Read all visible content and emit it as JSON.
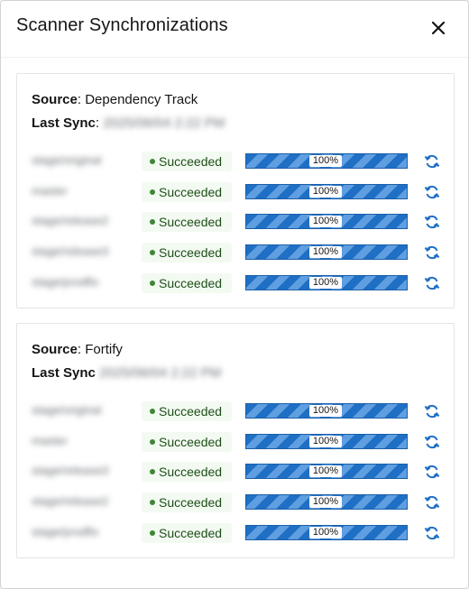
{
  "modal": {
    "title": "Scanner Synchronizations"
  },
  "sources": [
    {
      "source_label": "Source",
      "source_value": "Dependency Track",
      "last_sync_label": "Last Sync",
      "last_sync_value": "2025/06/04 2:22 PM",
      "rows": [
        {
          "branch": "stage/original",
          "status": "Succeeded",
          "progress": "100%"
        },
        {
          "branch": "master",
          "status": "Succeeded",
          "progress": "100%"
        },
        {
          "branch": "stage/release2",
          "status": "Succeeded",
          "progress": "100%"
        },
        {
          "branch": "stage/release3",
          "status": "Succeeded",
          "progress": "100%"
        },
        {
          "branch": "stage/prodfix",
          "status": "Succeeded",
          "progress": "100%"
        }
      ]
    },
    {
      "source_label": "Source",
      "source_value": "Fortify",
      "last_sync_label": "Last Sync",
      "last_sync_value": "2025/06/04 2:22 PM",
      "rows": [
        {
          "branch": "stage/original",
          "status": "Succeeded",
          "progress": "100%"
        },
        {
          "branch": "master",
          "status": "Succeeded",
          "progress": "100%"
        },
        {
          "branch": "stage/release3",
          "status": "Succeeded",
          "progress": "100%"
        },
        {
          "branch": "stage/release2",
          "status": "Succeeded",
          "progress": "100%"
        },
        {
          "branch": "stage/prodfix",
          "status": "Succeeded",
          "progress": "100%"
        }
      ]
    }
  ],
  "colors": {
    "accent": "#1f6fc5",
    "success_bg": "#f3faf2",
    "success_dot": "#3e8635",
    "success_text": "#1e4f18"
  },
  "icons": {
    "close": "close-icon",
    "refresh": "sync-icon"
  }
}
